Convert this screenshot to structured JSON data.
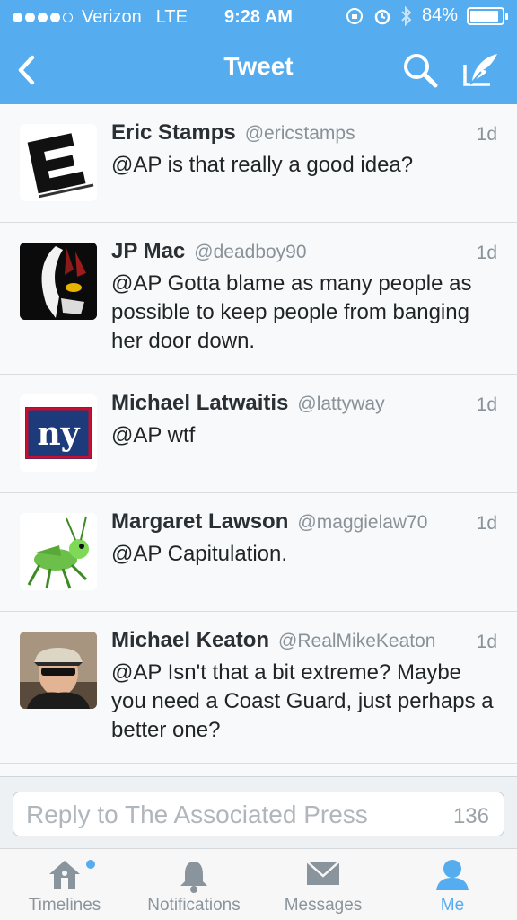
{
  "status_bar": {
    "carrier": "Verizon",
    "network": "LTE",
    "time": "9:28 AM",
    "battery": "84%",
    "battery_level": 0.84,
    "signal_bars_filled": 4,
    "signal_bars_total": 5
  },
  "nav": {
    "title": "Tweet",
    "back_icon": "chevron-left-icon",
    "search_icon": "search-icon",
    "compose_icon": "compose-icon"
  },
  "tweets": [
    {
      "name": "Eric Stamps",
      "handle": "@ericstamps",
      "time": "1d",
      "text": "@AP is that really a good idea?"
    },
    {
      "name": "JP Mac",
      "handle": "@deadboy90",
      "time": "1d",
      "text": "@AP Gotta blame as many people as possible to keep people from banging her door down."
    },
    {
      "name": "Michael Latwaitis",
      "handle": "@lattyway",
      "time": "1d",
      "text": "@AP wtf"
    },
    {
      "name": "Margaret Lawson",
      "handle": "@maggielaw70",
      "time": "1d",
      "text": "@AP Capitulation."
    },
    {
      "name": "Michael Keaton",
      "handle": "@RealMikeKeaton",
      "time": "1d",
      "text": "@AP Isn't that a bit extreme? Maybe you need a Coast Guard, just perhaps a better one?"
    }
  ],
  "reply": {
    "placeholder": "Reply to The Associated Press",
    "char_count": "136"
  },
  "tabs": [
    {
      "label": "Timelines",
      "icon": "home-icon",
      "active": false,
      "has_dot": true
    },
    {
      "label": "Notifications",
      "icon": "bell-icon",
      "active": false,
      "has_dot": false
    },
    {
      "label": "Messages",
      "icon": "envelope-icon",
      "active": false,
      "has_dot": false
    },
    {
      "label": "Me",
      "icon": "person-icon",
      "active": true,
      "has_dot": false
    }
  ],
  "colors": {
    "brand": "#55acee",
    "tab_inactive": "#8a949c"
  }
}
